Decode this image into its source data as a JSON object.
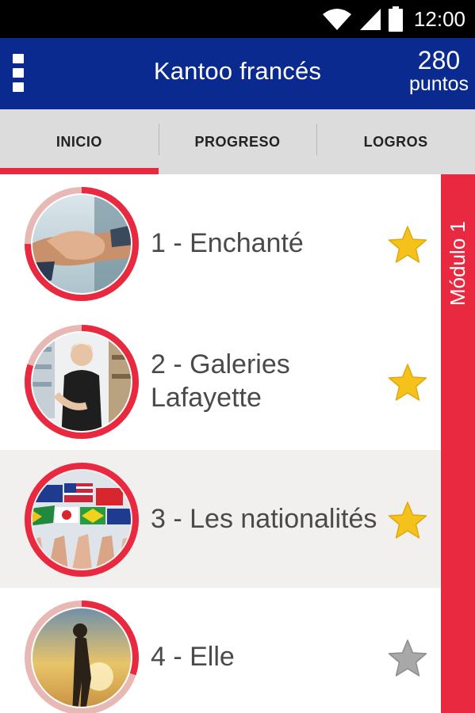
{
  "status_bar": {
    "time": "12:00",
    "icons": [
      "wifi-icon",
      "cell-signal-icon",
      "battery-icon"
    ]
  },
  "app_bar": {
    "title": "Kantoo francés",
    "points_value": "280",
    "points_label": "puntos",
    "menu_icon": "overflow-menu-icon"
  },
  "tabs": [
    {
      "label": "INICIO",
      "active": true
    },
    {
      "label": "PROGRESO",
      "active": false
    },
    {
      "label": "LOGROS",
      "active": false
    }
  ],
  "lessons": [
    {
      "title": "1 - Enchanté",
      "image": "handshake",
      "progress": 0.75,
      "starred": true
    },
    {
      "title": "2 - Galeries Lafayette",
      "image": "shop-assistant",
      "progress": 0.8,
      "starred": true
    },
    {
      "title": "3 - Les nationalités",
      "image": "world-flags",
      "progress": 1.0,
      "starred": true
    },
    {
      "title": "4 - Elle",
      "image": "woman-silhouette-sunset",
      "progress": 0.3,
      "starred": false
    }
  ],
  "module": {
    "label": "Módulo 1"
  },
  "colors": {
    "status_bar": "#000000",
    "app_bar": "#0a2a8f",
    "tabs_bg": "#dcdcdc",
    "accent_red": "#e8293f",
    "ring_track": "#e8b8b4",
    "star_gold": "#f5c21b",
    "star_gray": "#a8a8a8",
    "highlight_row": "#f2f0ef"
  }
}
